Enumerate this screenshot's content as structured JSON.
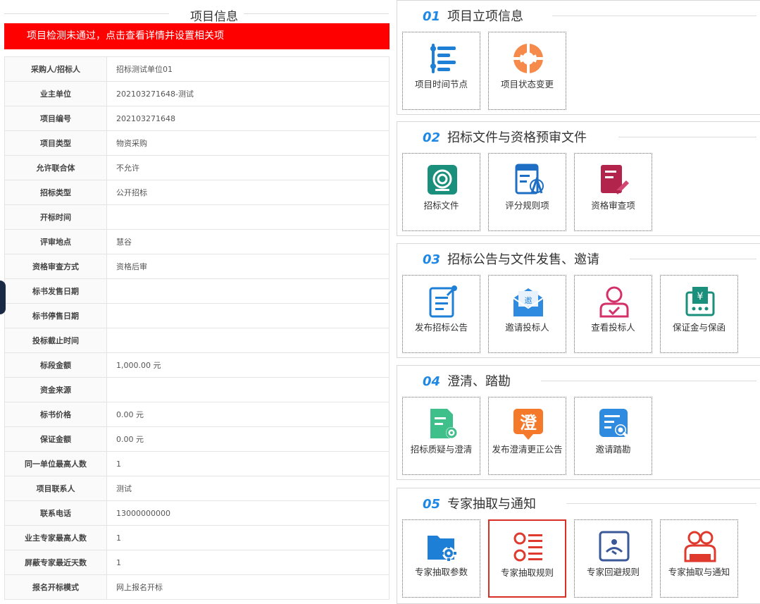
{
  "left_panel": {
    "title": "项目信息",
    "alert": "项目检测未通过，点击查看详情并设置相关项",
    "rows": [
      {
        "label": "采购人/招标人",
        "value": "招标测试单位01"
      },
      {
        "label": "业主单位",
        "value": "202103271648-测试"
      },
      {
        "label": "项目编号",
        "value": "202103271648"
      },
      {
        "label": "项目类型",
        "value": "物资采购"
      },
      {
        "label": "允许联合体",
        "value": "不允许"
      },
      {
        "label": "招标类型",
        "value": "公开招标"
      },
      {
        "label": "开标时间",
        "value": ""
      },
      {
        "label": "评审地点",
        "value": "慧谷"
      },
      {
        "label": "资格审查方式",
        "value": "资格后审"
      },
      {
        "label": "标书发售日期",
        "value": ""
      },
      {
        "label": "标书停售日期",
        "value": ""
      },
      {
        "label": "投标截止时间",
        "value": ""
      },
      {
        "label": "标段金额",
        "value": "1,000.00 元"
      },
      {
        "label": "资金来源",
        "value": ""
      },
      {
        "label": "标书价格",
        "value": "0.00 元"
      },
      {
        "label": "保证金额",
        "value": "0.00 元"
      },
      {
        "label": "同一单位最高人数",
        "value": "1"
      },
      {
        "label": "项目联系人",
        "value": "测试"
      },
      {
        "label": "联系电话",
        "value": "13000000000"
      },
      {
        "label": "业主专家最高人数",
        "value": "1"
      },
      {
        "label": "屏蔽专家最近天数",
        "value": "1"
      },
      {
        "label": "报名开标模式",
        "value": "网上报名开标"
      }
    ]
  },
  "sections": [
    {
      "num": "01",
      "title": "项目立项信息",
      "tiles": [
        {
          "label": "项目时间节点",
          "icon": "timeline-icon"
        },
        {
          "label": "项目状态变更",
          "icon": "status-change-icon"
        }
      ]
    },
    {
      "num": "02",
      "title": "招标文件与资格预审文件",
      "tiles": [
        {
          "label": "招标文件",
          "icon": "target-doc-icon"
        },
        {
          "label": "评分规则项",
          "icon": "scoring-rule-icon"
        },
        {
          "label": "资格审查项",
          "icon": "qualification-review-icon"
        }
      ]
    },
    {
      "num": "03",
      "title": "招标公告与文件发售、邀请",
      "tiles": [
        {
          "label": "发布招标公告",
          "icon": "publish-notice-icon"
        },
        {
          "label": "邀请投标人",
          "icon": "invite-envelope-icon"
        },
        {
          "label": "查看投标人",
          "icon": "view-bidder-icon"
        },
        {
          "label": "保证金与保函",
          "icon": "deposit-guarantee-icon"
        }
      ]
    },
    {
      "num": "04",
      "title": "澄清、踏勘",
      "tiles": [
        {
          "label": "招标质疑与澄清",
          "icon": "query-clarify-icon"
        },
        {
          "label": "发布澄清更正公告",
          "icon": "clarify-notice-icon"
        },
        {
          "label": "邀请踏勘",
          "icon": "site-survey-icon"
        }
      ]
    },
    {
      "num": "05",
      "title": "专家抽取与通知",
      "tiles": [
        {
          "label": "专家抽取参数",
          "icon": "expert-params-icon"
        },
        {
          "label": "专家抽取规则",
          "icon": "expert-rules-icon",
          "selected": true
        },
        {
          "label": "专家回避规则",
          "icon": "expert-avoid-icon"
        },
        {
          "label": "专家抽取与通知",
          "icon": "expert-notify-icon"
        }
      ]
    }
  ],
  "colors": {
    "alert": "#ff0000",
    "accent": "#1e88e5",
    "selected_border": "#d93025"
  }
}
